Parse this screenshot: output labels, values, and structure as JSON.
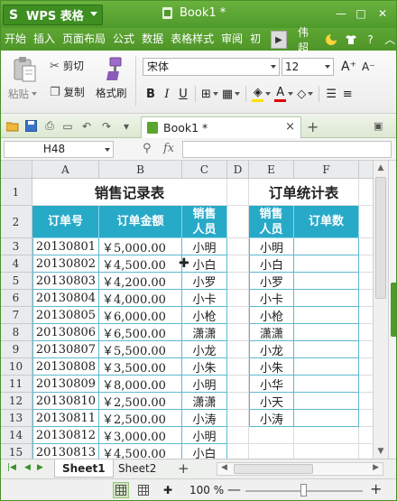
{
  "titlebar": {
    "app_name": "WPS 表格",
    "logo": "S",
    "doc_title": "Book1 *",
    "minimize": "—",
    "maximize": "□",
    "close": "✕"
  },
  "menubar": {
    "items": [
      "开始",
      "插入",
      "页面布局",
      "公式",
      "数据",
      "表格样式",
      "审阅",
      "初"
    ],
    "user": "伟超",
    "scroll_glyph": "▶"
  },
  "ribbon": {
    "paste": "粘贴",
    "cut": "剪切",
    "copy": "复制",
    "format_painter": "格式刷",
    "font_name": "宋体",
    "font_size": "12",
    "grow": "A⁺",
    "shrink": "A⁻",
    "bold": "B",
    "italic": "I",
    "underline": "U"
  },
  "tabs": {
    "doc_tab": "Book1 *",
    "close": "×",
    "add": "+"
  },
  "formula": {
    "name_box": "H48",
    "fx": "fx",
    "value": ""
  },
  "grid": {
    "col_headers": [
      "A",
      "B",
      "C",
      "D",
      "E",
      "F"
    ],
    "row_headers": [
      "1",
      "2",
      "3",
      "4",
      "5",
      "6",
      "7",
      "8",
      "9",
      "10",
      "11",
      "12",
      "13",
      "14",
      "15"
    ],
    "sales_title": "销售记录表",
    "orders_title": "订单统计表",
    "sales_headers": [
      "订单号",
      "订单金额",
      "销售人员"
    ],
    "order_headers": [
      "销售人员",
      "订单数"
    ],
    "sales_rows": [
      [
        "20130801",
        "￥5,000.00",
        "小明"
      ],
      [
        "20130802",
        "￥4,500.00",
        "小白"
      ],
      [
        "20130803",
        "￥4,200.00",
        "小罗"
      ],
      [
        "20130804",
        "￥4,000.00",
        "小卡"
      ],
      [
        "20130805",
        "￥6,000.00",
        "小枪"
      ],
      [
        "20130806",
        "￥6,500.00",
        "潇潇"
      ],
      [
        "20130807",
        "￥5,500.00",
        "小龙"
      ],
      [
        "20130808",
        "￥3,500.00",
        "小朱"
      ],
      [
        "20130809",
        "￥8,000.00",
        "小明"
      ],
      [
        "20130810",
        "￥2,500.00",
        "潇潇"
      ],
      [
        "20130811",
        "￥2,500.00",
        "小涛"
      ],
      [
        "20130812",
        "￥3,000.00",
        "小明"
      ],
      [
        "20130813",
        "￥4,500.00",
        "小白"
      ]
    ],
    "order_rows": [
      [
        "小明",
        ""
      ],
      [
        "小白",
        ""
      ],
      [
        "小罗",
        ""
      ],
      [
        "小卡",
        ""
      ],
      [
        "小枪",
        ""
      ],
      [
        "潇潇",
        ""
      ],
      [
        "小龙",
        ""
      ],
      [
        "小朱",
        ""
      ],
      [
        "小华",
        ""
      ],
      [
        "小天",
        ""
      ],
      [
        "小涛",
        ""
      ]
    ]
  },
  "sheets": {
    "tabs": [
      "Sheet1",
      "Sheet2"
    ],
    "active": "Sheet1",
    "add": "+"
  },
  "status": {
    "zoom": "100 %",
    "zoom_level_percent": 100,
    "minus": "—",
    "plus": "+"
  }
}
